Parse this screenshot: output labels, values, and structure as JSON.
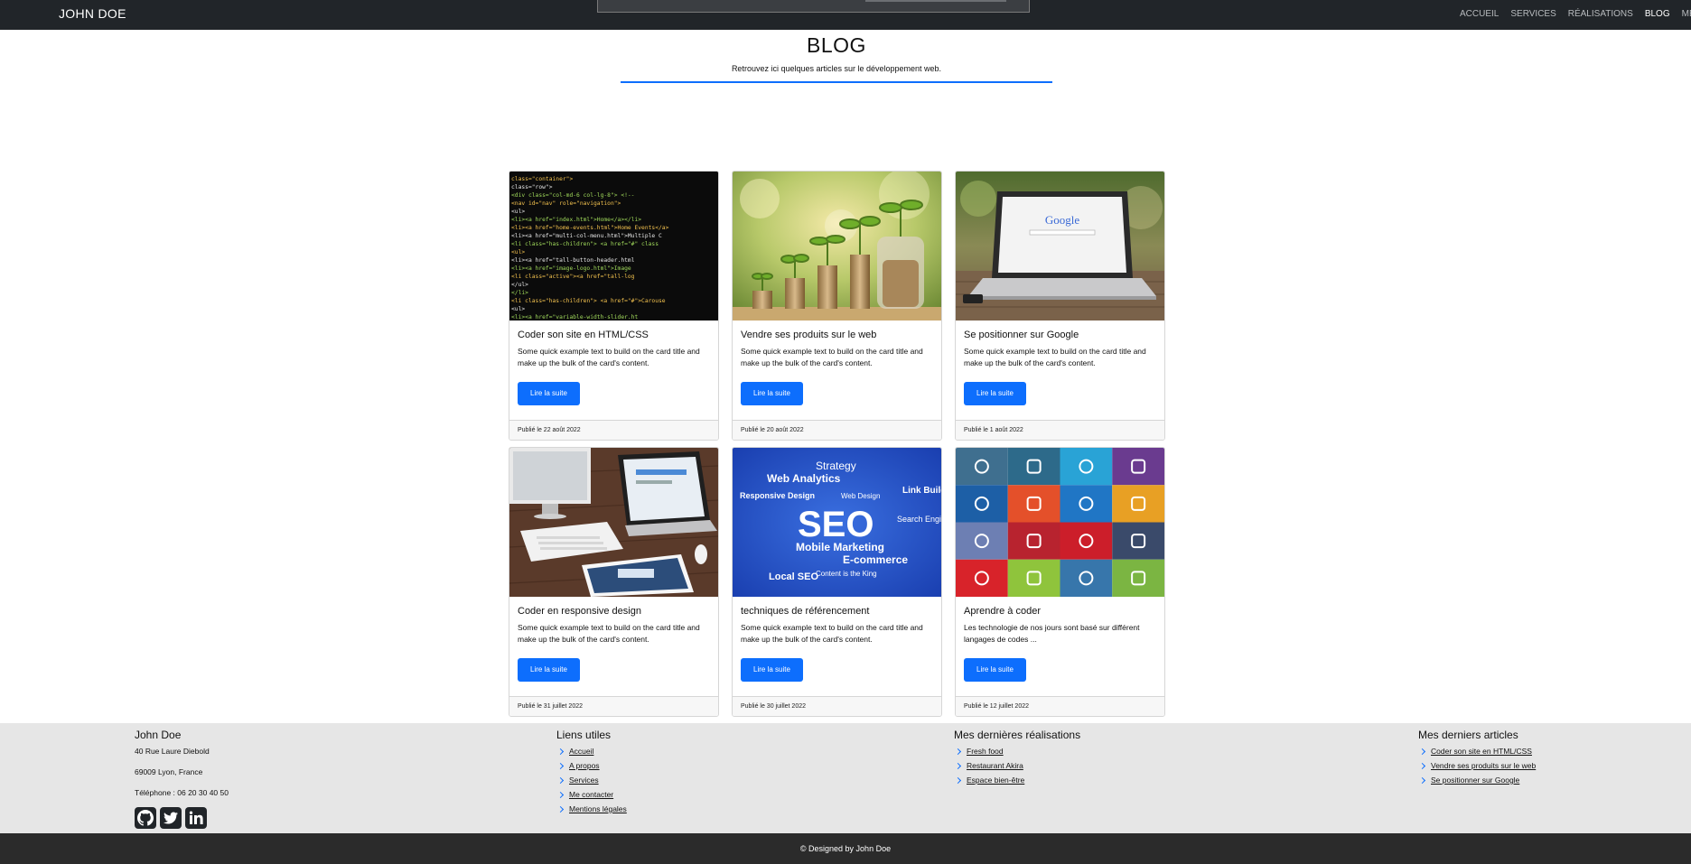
{
  "nav": {
    "brand": "JOHN DOE",
    "links": [
      "ACCUEIL",
      "SERVICES",
      "RÉALISATIONS",
      "BLOG",
      "ME CONTACTER"
    ],
    "active": "BLOG"
  },
  "header": {
    "title": "BLOG",
    "subtitle": "Retrouvez ici quelques articles sur le développement web.",
    "accent": "#0d6efd"
  },
  "cards": [
    {
      "title": "Coder son site en HTML/CSS",
      "text": "Some quick example text to build on the card title and make up the bulk of the card's content.",
      "button": "Lire la suite",
      "date": "Publié le 22 août 2022",
      "image": "code-html-image"
    },
    {
      "title": "Vendre ses produits sur le web",
      "text": "Some quick example text to build on the card title and make up the bulk of the card's content.",
      "button": "Lire la suite",
      "date": "Publié le 20 août 2022",
      "image": "coins-plants-image"
    },
    {
      "title": "Se positionner sur Google",
      "text": "Some quick example text to build on the card title and make up the bulk of the card's content.",
      "button": "Lire la suite",
      "date": "Publié le 1 août 2022",
      "image": "laptop-google-image"
    },
    {
      "title": "Coder en responsive design",
      "text": "Some quick example text to build on the card title and make up the bulk of the card's content.",
      "button": "Lire la suite",
      "date": "Publié le 31 juillet 2022",
      "image": "devices-desk-image"
    },
    {
      "title": "techniques de référencement",
      "text": "Some quick example text to build on the card title and make up the bulk of the card's content.",
      "button": "Lire la suite",
      "date": "Publié le 30 juillet 2022",
      "image": "seo-wordcloud-image"
    },
    {
      "title": "Aprendre à coder",
      "text": "Les technologie de nos jours sont basé sur différent langages de codes ...",
      "button": "Lire la suite",
      "date": "Publié le 12 juillet 2022",
      "image": "tech-logos-grid-image"
    }
  ],
  "seo_words": {
    "main": "SEO",
    "w1": "Strategy",
    "w2": "Web Analytics",
    "w3": "Mobile Marketing",
    "w4": "E-commerce",
    "w5": "Local SEO",
    "w6": "Content is the King",
    "w7": "Responsive Design",
    "w8": "Link Building",
    "w9": "Search Engine",
    "w10": "Web Design"
  },
  "laptop_screen": {
    "word": "Google"
  },
  "code_lines": [
    "class=\"container\">",
    " class=\"row\">",
    "  <div class=\"col-md-6 col-lg-8\"> <!--",
    "   <nav id=\"nav\" role=\"navigation\">",
    "    <ul>",
    "     <li><a href=\"index.html\">Home</a></li>",
    "     <li><a href=\"home-events.html\">Home Events</a>",
    "     <li><a href=\"multi-col-menu.html\">Multiple C",
    "     <li class=\"has-children\"> <a href=\"#\" class",
    "      <ul>",
    "       <li><a href=\"tall-button-header.html",
    "       <li><a href=\"image-logo.html\">Image",
    "       <li class=\"active\"><a href=\"tall-log",
    "      </ul>",
    "     </li>",
    "     <li class=\"has-children\"> <a href=\"#\">Carouse",
    "      <ul>",
    "       <li><a href=\"variable-width-slider.ht"
  ],
  "footer": {
    "name": "John Doe",
    "address": "40 Rue Laure Diebold",
    "city": "69009 Lyon, France",
    "phone": "Téléphone : 06 20 30 40 50",
    "socials": [
      "github-icon",
      "twitter-icon",
      "linkedin-icon"
    ],
    "useful_title": "Liens utiles",
    "useful": [
      "Accueil",
      "A propos",
      "Services",
      "Me contacter",
      "Mentions légales"
    ],
    "works_title": "Mes dernières réalisations",
    "works": [
      "Fresh food",
      "Restaurant Akira",
      "Espace bien-être"
    ],
    "articles_title": "Mes derniers articles",
    "articles": [
      "Coder son site en HTML/CSS",
      "Vendre ses produits sur le web",
      "Se positionner sur Google"
    ],
    "copyright": "© Designed by John Doe"
  }
}
